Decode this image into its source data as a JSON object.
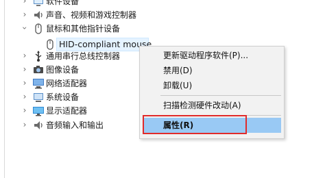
{
  "tree": {
    "items": [
      {
        "label": "软件设备",
        "expanded": false
      },
      {
        "label": "声音、视频和游戏控制器",
        "expanded": false
      },
      {
        "label": "鼠标和其他指针设备",
        "expanded": true
      },
      {
        "label": "HID-compliant mouse",
        "child": true,
        "selected": true
      },
      {
        "label": "通用串行总线控制器",
        "expanded": false
      },
      {
        "label": "图像设备",
        "expanded": false
      },
      {
        "label": "网络适配器",
        "expanded": false
      },
      {
        "label": "系统设备",
        "expanded": false
      },
      {
        "label": "显示适配器",
        "expanded": false
      },
      {
        "label": "音频输入和输出",
        "expanded": false
      }
    ]
  },
  "context_menu": {
    "items": [
      {
        "label": "更新驱动程序软件(P)..."
      },
      {
        "label": "禁用(D)"
      },
      {
        "label": "卸载(U)"
      },
      {
        "label": "扫描检测硬件改动(A)"
      },
      {
        "label": "属性(R)",
        "highlighted": true
      }
    ]
  },
  "colors": {
    "menu_highlight": "#99c9f4",
    "annotation_box": "#e02a2a",
    "selection": "#e5f3ff"
  }
}
